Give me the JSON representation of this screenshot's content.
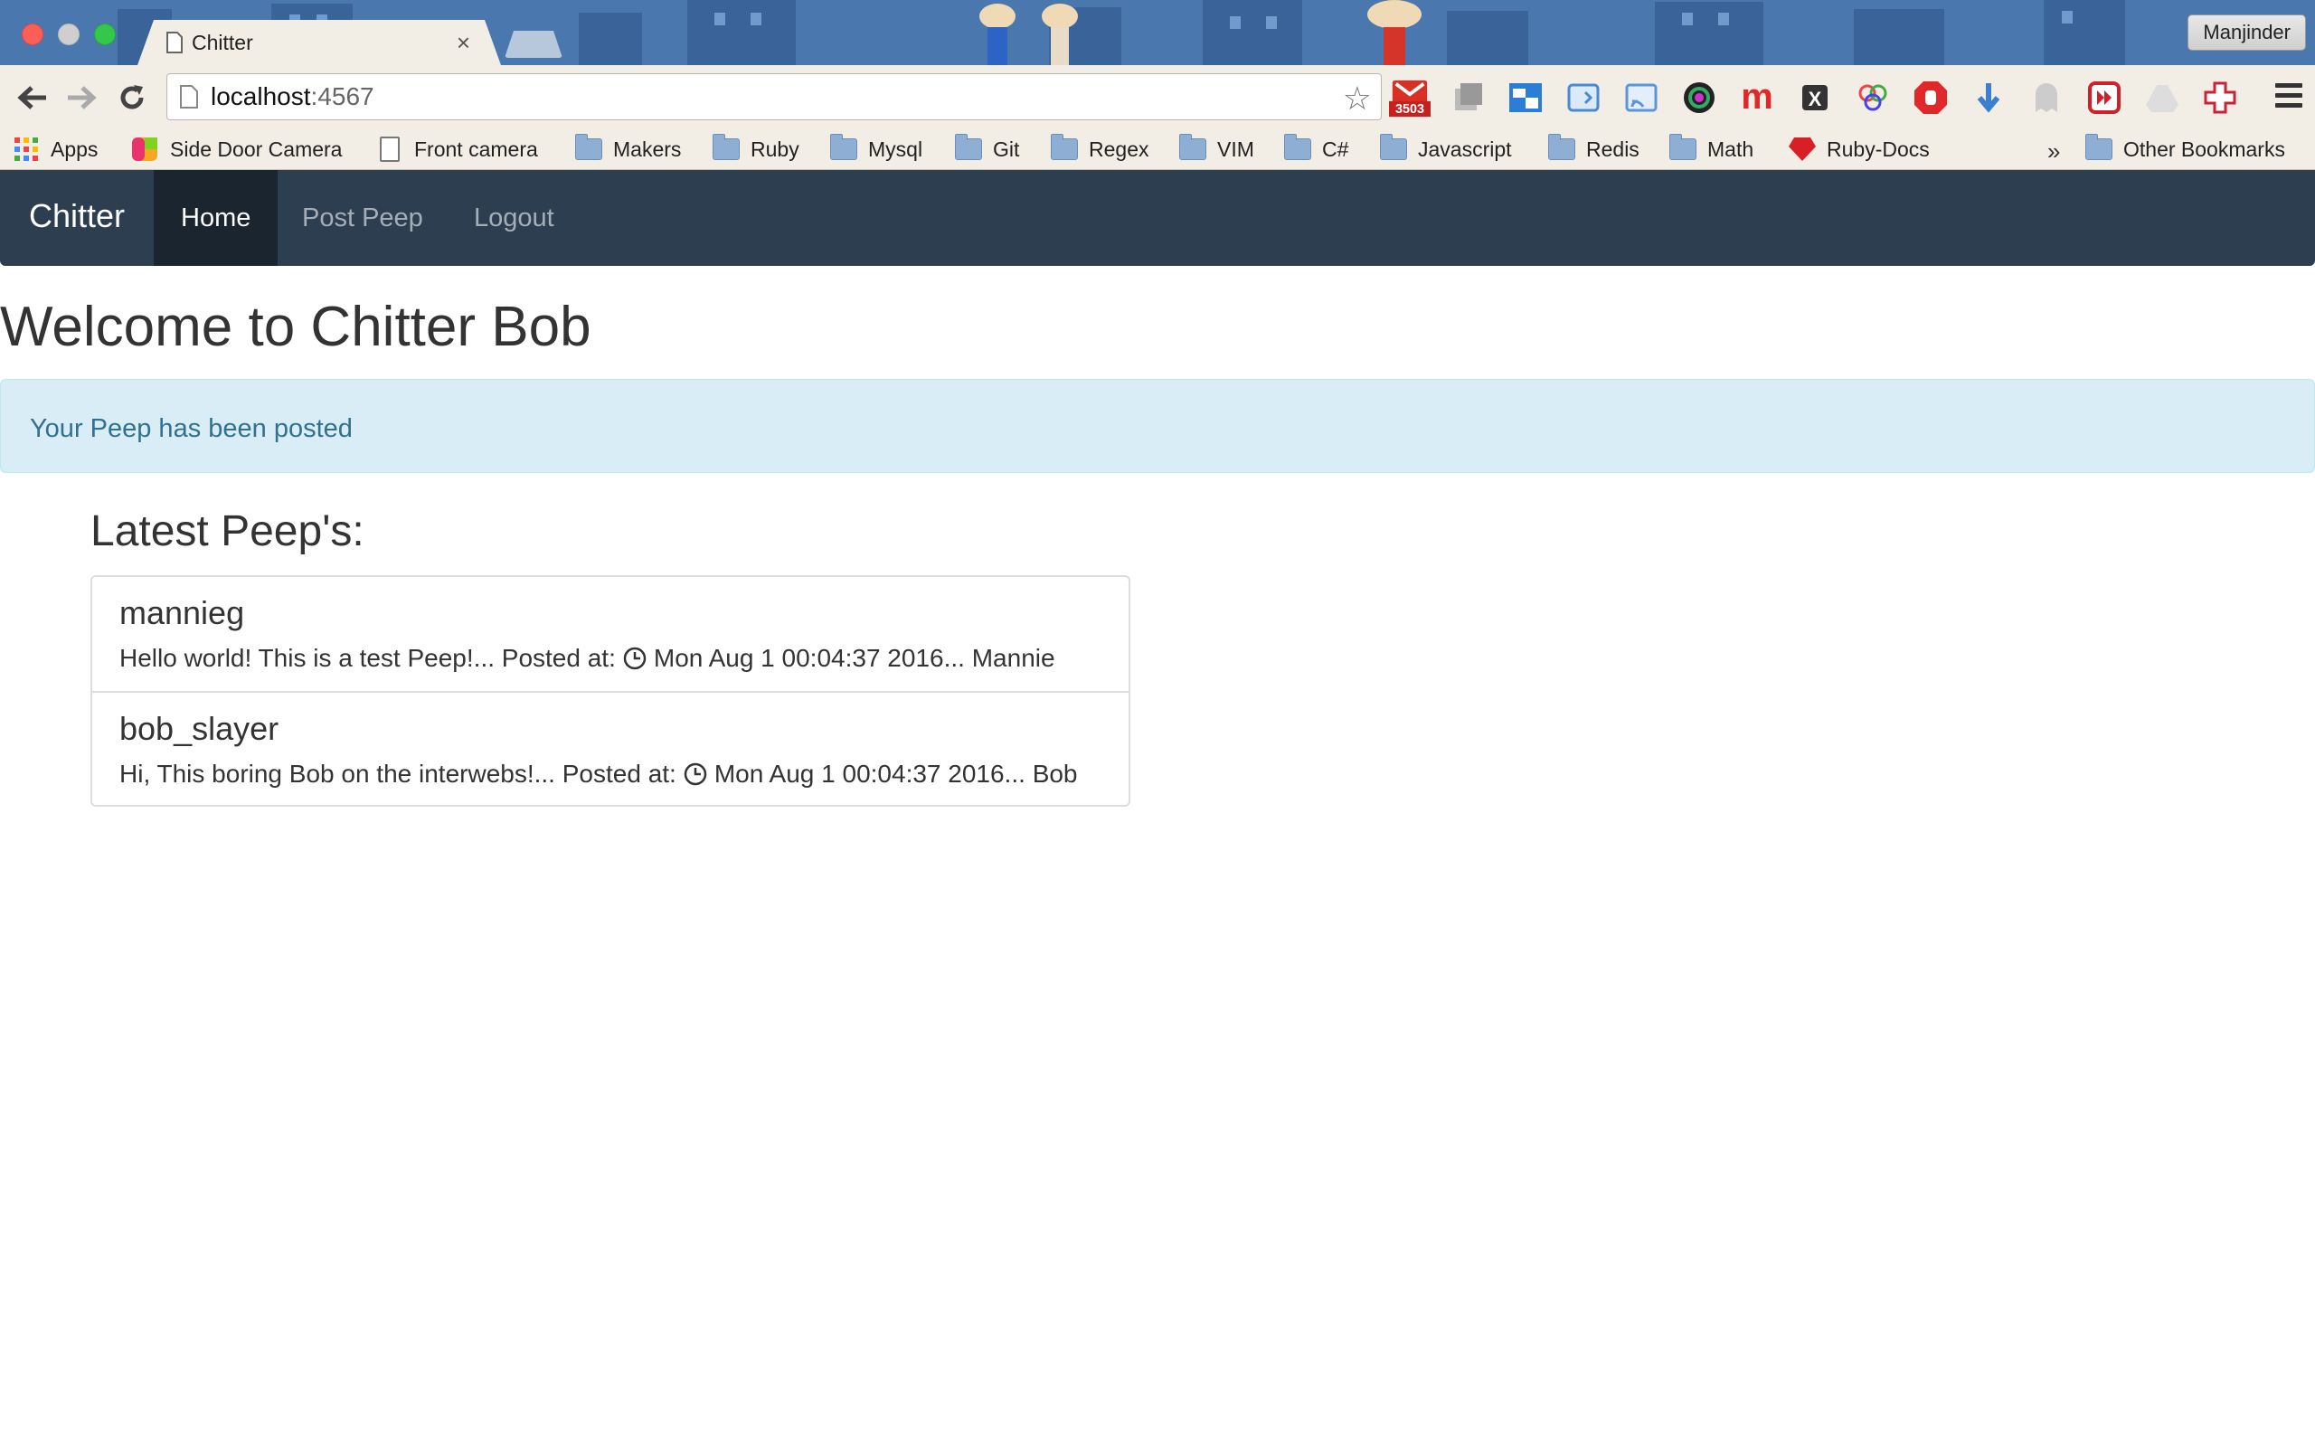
{
  "browser": {
    "tab": {
      "title": "Chitter",
      "close": "×"
    },
    "profile": "Manjinder",
    "url": {
      "host": "localhost",
      "port": ":4567"
    },
    "bookmarks": [
      {
        "label": "Apps",
        "icon": "apps-grid-icon"
      },
      {
        "label": "Side Door Camera",
        "icon": "colorful-app-icon"
      },
      {
        "label": "Front camera",
        "icon": "page-icon"
      },
      {
        "label": "Makers",
        "icon": "folder-icon"
      },
      {
        "label": "Ruby",
        "icon": "folder-icon"
      },
      {
        "label": "Mysql",
        "icon": "folder-icon"
      },
      {
        "label": "Git",
        "icon": "folder-icon"
      },
      {
        "label": "Regex",
        "icon": "folder-icon"
      },
      {
        "label": "VIM",
        "icon": "folder-icon"
      },
      {
        "label": "C#",
        "icon": "folder-icon"
      },
      {
        "label": "Javascript",
        "icon": "folder-icon"
      },
      {
        "label": "Redis",
        "icon": "folder-icon"
      },
      {
        "label": "Math",
        "icon": "folder-icon"
      },
      {
        "label": "Ruby-Docs",
        "icon": "ruby-icon"
      }
    ],
    "bookmarks_overflow": "»",
    "other_bookmarks": "Other Bookmarks",
    "gmail_badge": "3503",
    "extension_letters": {
      "m": "m",
      "x": "X"
    }
  },
  "site": {
    "brand": "Chitter",
    "nav": [
      {
        "label": "Home",
        "active": true
      },
      {
        "label": "Post Peep",
        "active": false
      },
      {
        "label": "Logout",
        "active": false
      }
    ],
    "page_title": "Welcome to Chitter Bob",
    "alert": "Your Peep has been posted",
    "section_title": "Latest Peep's:",
    "peeps": [
      {
        "username": "mannieg",
        "message": "Hello world! This is a test Peep!...",
        "posted_label": "Posted at:",
        "timestamp": "Mon Aug 1 00:04:37 2016...",
        "author": "Mannie"
      },
      {
        "username": "bob_slayer",
        "message": "Hi, This boring Bob on the interwebs!...",
        "posted_label": "Posted at:",
        "timestamp": "Mon Aug 1 00:04:37 2016...",
        "author": "Bob"
      }
    ]
  },
  "colors": {
    "navbar": "#2c3e50",
    "navbar_active": "#1a252f",
    "alert_bg": "#d9edf7",
    "alert_text": "#31708f",
    "chrome_bg": "#f2eee6"
  }
}
